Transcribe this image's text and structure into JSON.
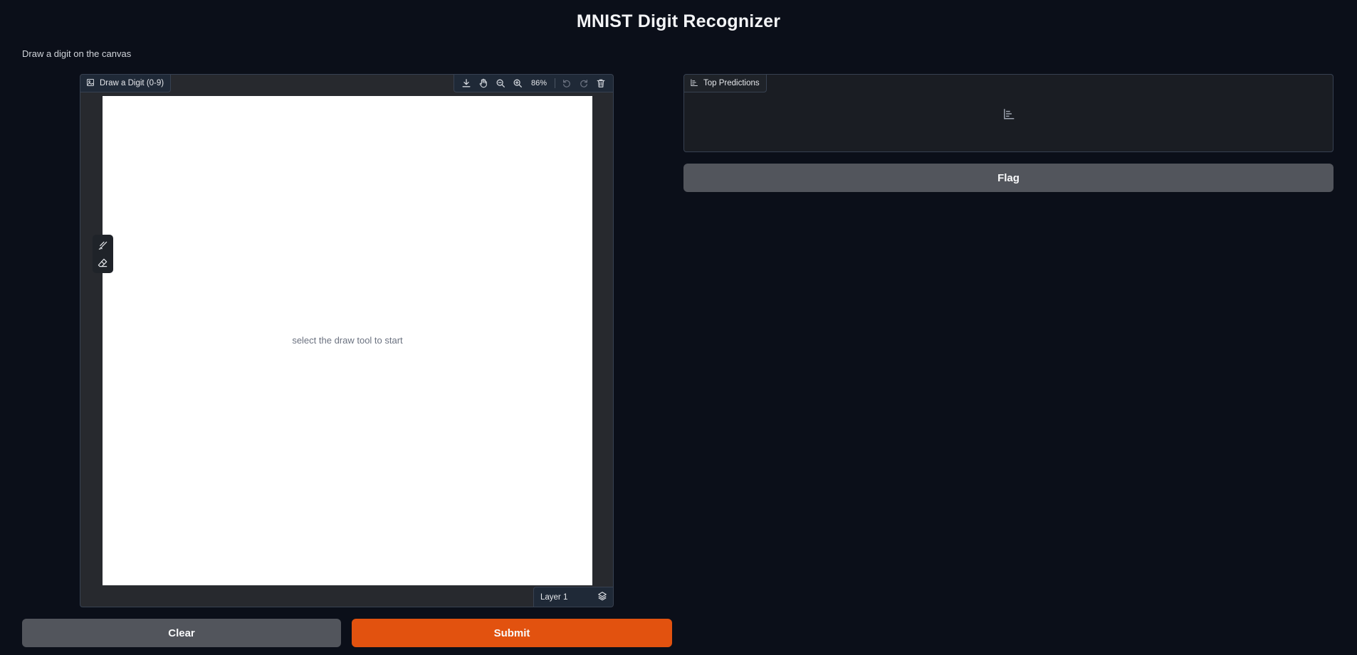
{
  "page": {
    "title": "MNIST Digit Recognizer",
    "description": "Draw a digit on the canvas"
  },
  "sketchpad": {
    "label": "Draw a Digit (0-9)",
    "label_icon": "image-icon",
    "toolbar": {
      "download_icon": "download-icon",
      "pan_icon": "hand-pan-icon",
      "zoom_out_icon": "zoom-out-icon",
      "zoom_in_icon": "zoom-in-icon",
      "zoom_level": "86%",
      "undo_icon": "undo-icon",
      "redo_icon": "redo-icon",
      "clear_icon": "trash-icon"
    },
    "hint": "select the draw tool to start",
    "tools": [
      "brush-icon",
      "eraser-icon"
    ],
    "layer_label": "Layer 1",
    "layer_icon": "layers-icon",
    "canvas_color": "#ffffff"
  },
  "predictions": {
    "label": "Top Predictions",
    "label_icon": "bar-chart-icon",
    "empty_icon": "bar-chart-icon"
  },
  "buttons": {
    "clear": "Clear",
    "submit": "Submit",
    "flag": "Flag"
  },
  "colors": {
    "background": "#0b0f19",
    "primary": "#e2520f",
    "secondary": "#52555c"
  }
}
